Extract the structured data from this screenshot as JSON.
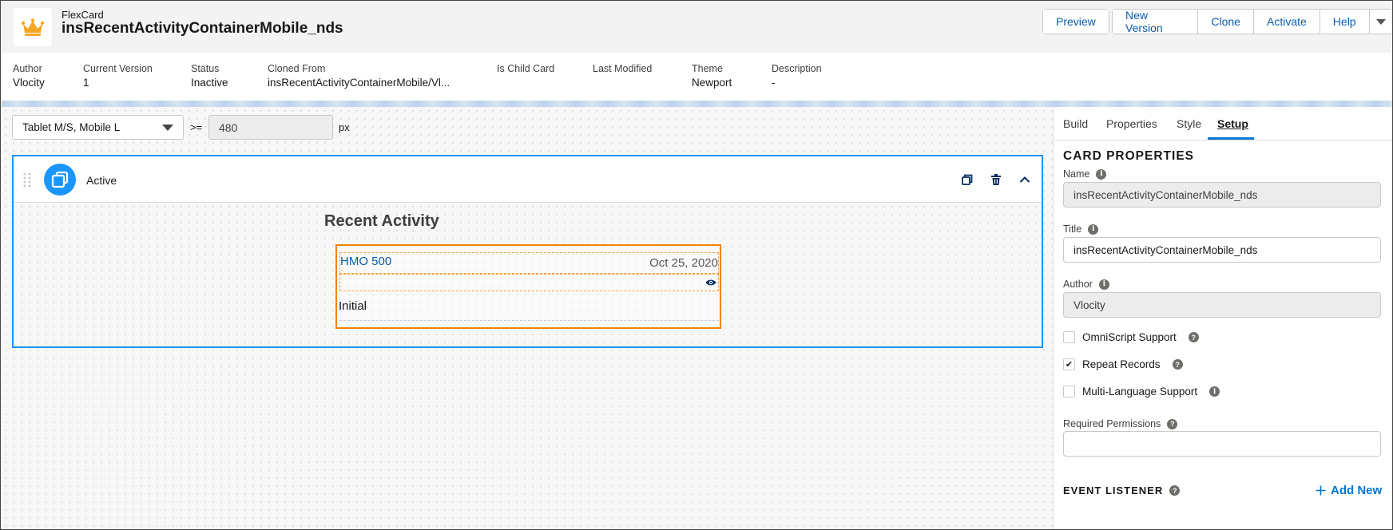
{
  "header": {
    "type_label": "FlexCard",
    "title": "insRecentActivityContainerMobile_nds",
    "buttons": {
      "preview": "Preview",
      "new_version": "New Version",
      "clone": "Clone",
      "activate": "Activate",
      "help": "Help"
    },
    "icon": "crown-icon",
    "colors": {
      "accent": "#0b5cab",
      "logo": "#f5a623"
    }
  },
  "info": {
    "author": {
      "label": "Author",
      "value": "Vlocity"
    },
    "current_version": {
      "label": "Current Version",
      "value": "1"
    },
    "status": {
      "label": "Status",
      "value": "Inactive"
    },
    "cloned_from": {
      "label": "Cloned From",
      "value": "insRecentActivityContainerMobile/Vl..."
    },
    "is_child_card": {
      "label": "Is Child Card",
      "value": ""
    },
    "last_modified": {
      "label": "Last Modified",
      "value": ""
    },
    "theme": {
      "label": "Theme",
      "value": "Newport"
    },
    "description": {
      "label": "Description",
      "value": "-"
    }
  },
  "canvas": {
    "breakpoint": {
      "selected": "Tablet M/S, Mobile L",
      "operator": ">=",
      "value": "480",
      "unit": "px"
    },
    "card": {
      "state_label": "Active",
      "title": "Recent Activity",
      "item": {
        "plan": "HMO 500",
        "date": "Oct 25, 2020",
        "status": "Initial"
      }
    }
  },
  "panel": {
    "tabs": [
      "Build",
      "Properties",
      "Style",
      "Setup"
    ],
    "active_tab": "Setup",
    "card_properties": {
      "heading": "CARD PROPERTIES",
      "name": {
        "label": "Name",
        "value": "insRecentActivityContainerMobile_nds"
      },
      "title": {
        "label": "Title",
        "value": "insRecentActivityContainerMobile_nds"
      },
      "author": {
        "label": "Author",
        "value": "Vlocity"
      },
      "omniscript_support": {
        "label": "OmniScript Support",
        "checked": false
      },
      "repeat_records": {
        "label": "Repeat Records",
        "checked": true
      },
      "multi_language": {
        "label": "Multi-Language Support",
        "checked": false
      },
      "required_permissions": {
        "label": "Required Permissions",
        "value": ""
      }
    },
    "event_listener": {
      "heading": "EVENT LISTENER",
      "add_label": "Add New"
    }
  }
}
